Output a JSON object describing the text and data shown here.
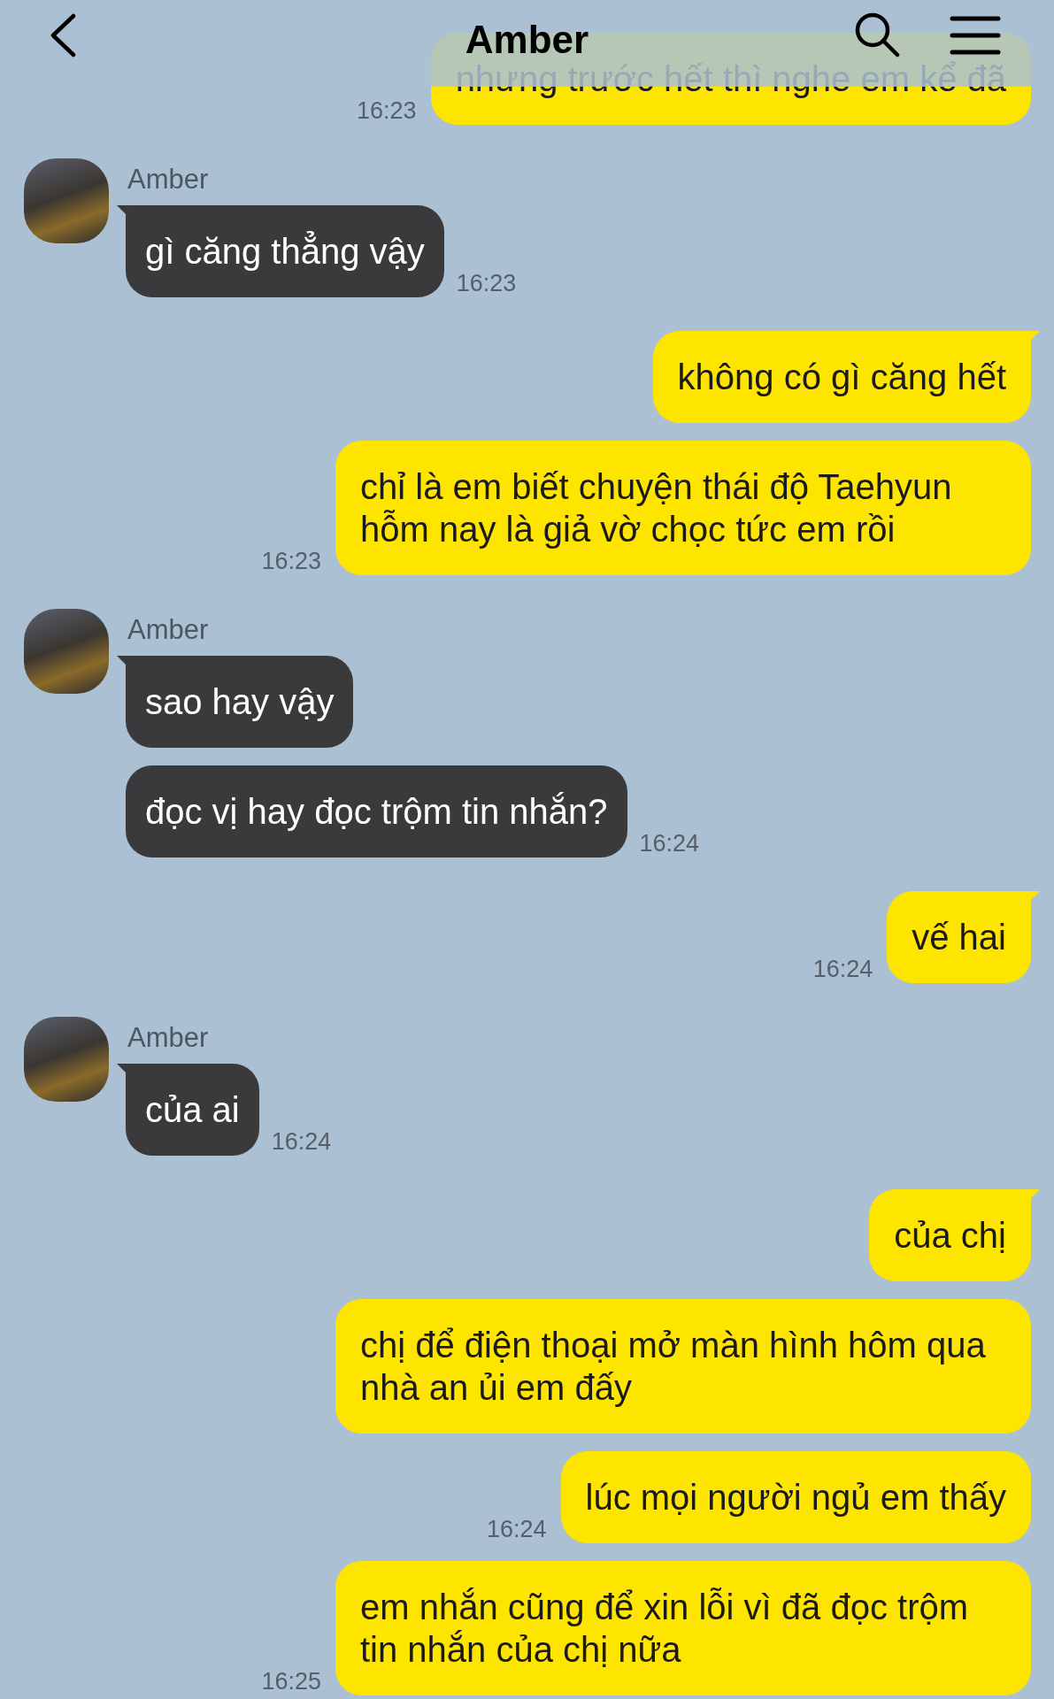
{
  "header": {
    "title": "Amber"
  },
  "messages": [
    {
      "kind": "sent",
      "text": "nhưng trước hết thì nghe em kể đã",
      "time": "16:23",
      "tail": false
    },
    {
      "kind": "received",
      "sender": "Amber",
      "text": "gì căng thẳng vậy",
      "time": "16:23",
      "tail": true
    },
    {
      "kind": "sent",
      "text": "không có gì căng hết",
      "tail": true
    },
    {
      "kind": "sent",
      "text": "chỉ là em biết chuyện thái độ Taehyun hỗm nay là giả vờ chọc tức em rồi",
      "time": "16:23",
      "tail": false
    },
    {
      "kind": "received",
      "sender": "Amber",
      "text": "sao hay vậy",
      "tail": true
    },
    {
      "kind": "received",
      "text": "đọc vị hay đọc trộm tin nhắn?",
      "time": "16:24",
      "tail": false
    },
    {
      "kind": "sent",
      "text": "vế hai",
      "time": "16:24",
      "tail": true
    },
    {
      "kind": "received",
      "sender": "Amber",
      "text": "của ai",
      "time": "16:24",
      "tail": true
    },
    {
      "kind": "sent",
      "text": "của chị",
      "tail": true
    },
    {
      "kind": "sent",
      "text": "chị để điện thoại mở màn hình hôm qua nhà an ủi em đấy",
      "tail": false
    },
    {
      "kind": "sent",
      "text": "lúc mọi người ngủ em thấy",
      "time": "16:24",
      "tail": false
    },
    {
      "kind": "sent",
      "text": "em nhắn cũng để xin lỗi vì đã đọc trộm tin nhắn của chị nữa",
      "time": "16:25",
      "tail": false
    }
  ]
}
